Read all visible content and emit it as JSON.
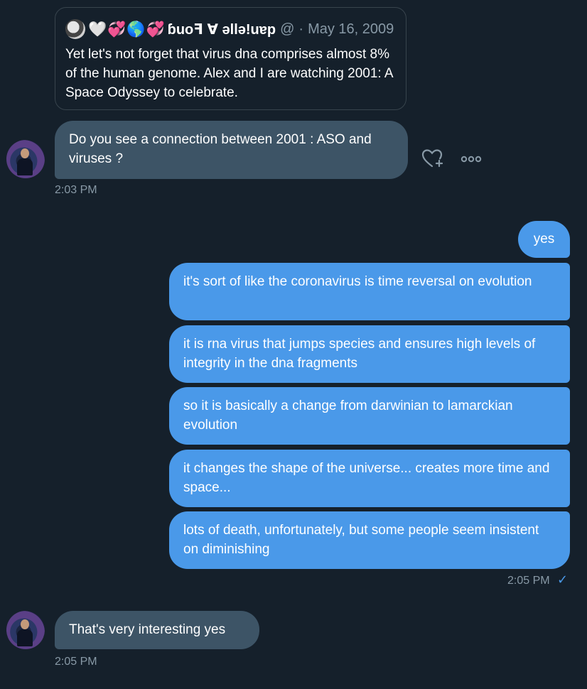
{
  "quote": {
    "emojis": [
      "🤍",
      "💞",
      "🌎",
      "💞"
    ],
    "name": "ɓuoꟻ ∀ ǝllǝ!uɐp",
    "handle": "@",
    "date": "May 16, 2009",
    "text": "Yet let's not forget that virus dna comprises almost 8% of the human genome. Alex and I are watching 2001: A Space Odyssey to celebrate."
  },
  "messages": {
    "incoming_1": {
      "text": "Do you see a connection between 2001 : ASO and viruses ?",
      "time": "2:03 PM"
    },
    "outgoing": [
      "yes",
      "it's sort of like the coronavirus is time reversal on evolution",
      "it is rna virus that jumps species and ensures high levels of integrity in the dna fragments",
      "so it is basically a change from darwinian to lamarckian evolution",
      "it changes the shape of the universe... creates more time and space...",
      "lots of death, unfortunately, but some people seem insistent on diminishing"
    ],
    "outgoing_time": "2:05 PM",
    "outgoing_status_icon": "✓",
    "incoming_2": {
      "text": "That's very interesting yes",
      "time": "2:05 PM"
    }
  },
  "actions": {
    "react_icon": "heart-plus-icon",
    "more_icon": "more-dots-icon"
  },
  "colors": {
    "background": "#15202b",
    "incoming_bubble": "#3d5466",
    "outgoing_bubble": "#4a99e9",
    "muted_text": "#8899a6",
    "quote_border": "#38444d"
  }
}
